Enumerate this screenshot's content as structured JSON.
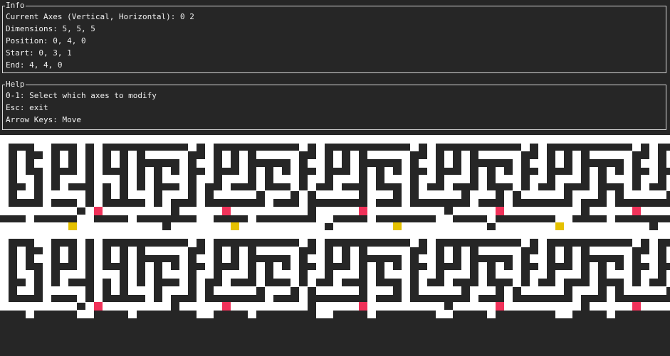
{
  "info": {
    "title": "Info",
    "lines": [
      "Current Axes (Vertical, Horizontal): 0 2",
      "Dimensions: 5, 5, 5",
      "Position: 0, 4, 0",
      "Start: 0, 3, 1",
      "End: 4, 4, 0"
    ]
  },
  "help": {
    "title": "Help",
    "lines": [
      "0-1: Select which axes to modify",
      "Esc: exit",
      "Arrow Keys: Move"
    ]
  },
  "maze": {
    "colors": {
      "wall": "#262626",
      "path": "#ffffff",
      "start": "#f0325a",
      "end": "#e5c100"
    },
    "cols": 78,
    "rows": 28,
    "grid": [
      "..........................................................................................",
      ".###..###.#.##########.#.##########.#.##########.#.##########.#.##########.#.##########.#",
      ".#.##.#.#.#.#.#.#.....##.#.#.#.....##.#.#.#.....##.#.#.#.....##.#.#.#.....##.#.#.#.....##",
      ".#.#..#.#.#.#.#.#####.#..#.#.#####.#..#.#.#####.#..#.#.#####.#..#.#.#####.#..#.#.#####.#",
      ".#.##.###.#.###.#.#.#.##.###.#.#.#.##.###.#.#.#.##.###.#.#.#.##.###.#.#.#.##.###.#.#.#.#",
      ".#..#.#...#...#.#.#...#..#...#.#...#..#...#.#...#..#...#.#...#..#...#.#...#..#...#.#...#",
      ".##.#.#.###.#.#.#.###.#.##.###.###.#.##.###.###.#.##.###.###.#.##.###.###.#.##.###.###.#",
      ".#..#.....#.#.#...#...#.#.....#...#.#.....#...#.#.....#...#.#.....#...#.#.....#...#.#.##",
      ".####.###.#.#####.#.###.#######.###.#######.###.#######.###.#######.###.#######.###.####",
      ".........#.R........#.....R.........#.....R.........#.....R.........#.....R.........#.....R.",
      "###.#####..####.#######..####.#######..####.#######..####.#######..####.#######..####.##",
      "........Y..........#.......Y..........#.......Y..........#.......Y..........#.......Y...",
      ".........................................................................................",
      ".###..###.#.##########.#.##########.#.##########.#.##########.#.##########.#.##########.#",
      ".#.##.#.#.#.#.#.#.....##.#.#.#.....##.#.#.#.....##.#.#.#.....##.#.#.#.....##.#.#.#.....##",
      ".#.#..#.#.#.#.#.#####.#..#.#.#####.#..#.#.#####.#..#.#.#####.#..#.#.#####.#..#.#.#####.#",
      ".#.##.###.#.###.#.#.#.##.###.#.#.#.##.###.#.#.#.##.###.#.#.#.##.###.#.#.#.##.###.#.#.#.#",
      ".#..#.#...#...#.#.#...#..#...#.#...#..#...#.#...#..#...#.#...#..#...#.#...#..#...#.#...#",
      ".##.#.#.###.#.#.#.###.#.##.###.###.#.##.###.###.#.##.###.###.#.##.###.###.#.##.###.###.#",
      ".#..#.....#.#.#...#...#.#.....#...#.#.....#...#.#.....#...#.#.....#...#.#.....#...#.#.##",
      ".####.###.#.#####.#.###.#######.###.#######.###.#######.###.#######.###.#######.###.####",
      ".........#.R........#.....R.........#.....R.........#.....R.........#.....R.........#.....R.",
      "###.#####..####.#######..####.#######..####.#######..####.#######..####.#######..####.##"
    ]
  }
}
